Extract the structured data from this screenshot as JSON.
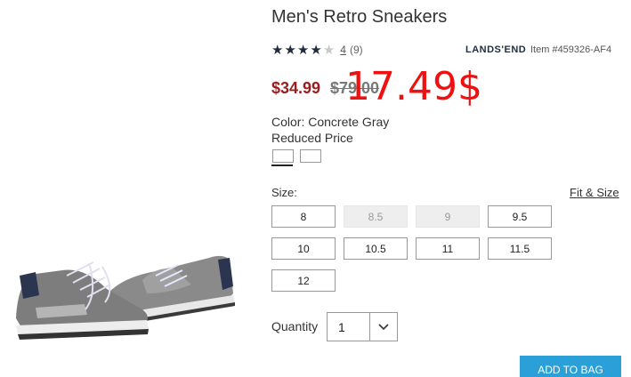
{
  "product": {
    "title": "Men's Retro Sneakers",
    "rating_value": 4,
    "rating_out_of": 5,
    "rating_link": "4",
    "rating_count": "(9)",
    "brand": "LANDS'END",
    "item_number": "Item #459326-AF4"
  },
  "price": {
    "sale": "$34.99",
    "original": "$79.00",
    "annotation": "17.49$"
  },
  "color": {
    "label": "Color: Concrete Gray",
    "reduced": "Reduced Price"
  },
  "size": {
    "label": "Size:",
    "fit_link": "Fit & Size",
    "options": [
      "8",
      "8.5",
      "9",
      "9.5",
      "10",
      "10.5",
      "11",
      "11.5",
      "12"
    ],
    "unavailable": [
      "8.5",
      "9"
    ]
  },
  "quantity": {
    "label": "Quantity",
    "value": "1"
  },
  "cart": {
    "add_label": "ADD TO BAG"
  },
  "colors": {
    "sale_price": "#9c1c1c",
    "annotation": "#ee1111",
    "add_button": "#2a9fd8"
  }
}
